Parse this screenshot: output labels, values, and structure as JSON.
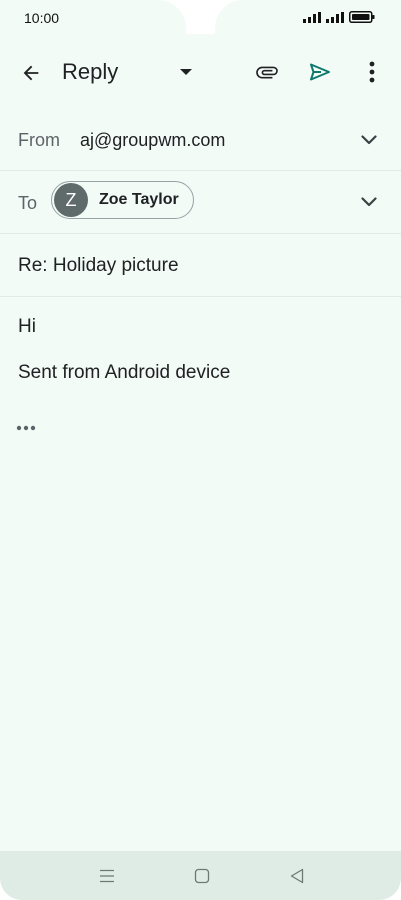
{
  "status_bar": {
    "time": "10:00"
  },
  "app_bar": {
    "title": "Reply",
    "icons": {
      "back": "arrow-back-icon",
      "dropdown": "caret-down-icon",
      "attach": "paperclip-icon",
      "send": "send-icon",
      "more": "more-vert-icon"
    },
    "send_color": "#0f7a6b"
  },
  "from": {
    "label": "From",
    "value": "aj@groupwm.com"
  },
  "to": {
    "label": "To",
    "chip": {
      "initial": "Z",
      "name": "Zoe Taylor"
    }
  },
  "subject": {
    "value": "Re: Holiday picture"
  },
  "body": {
    "line1": "Hi",
    "line2": "Sent from Android device"
  },
  "colors": {
    "background": "#f3fbf7",
    "nav_bar": "#dfece6",
    "avatar": "#5f6b6b"
  }
}
